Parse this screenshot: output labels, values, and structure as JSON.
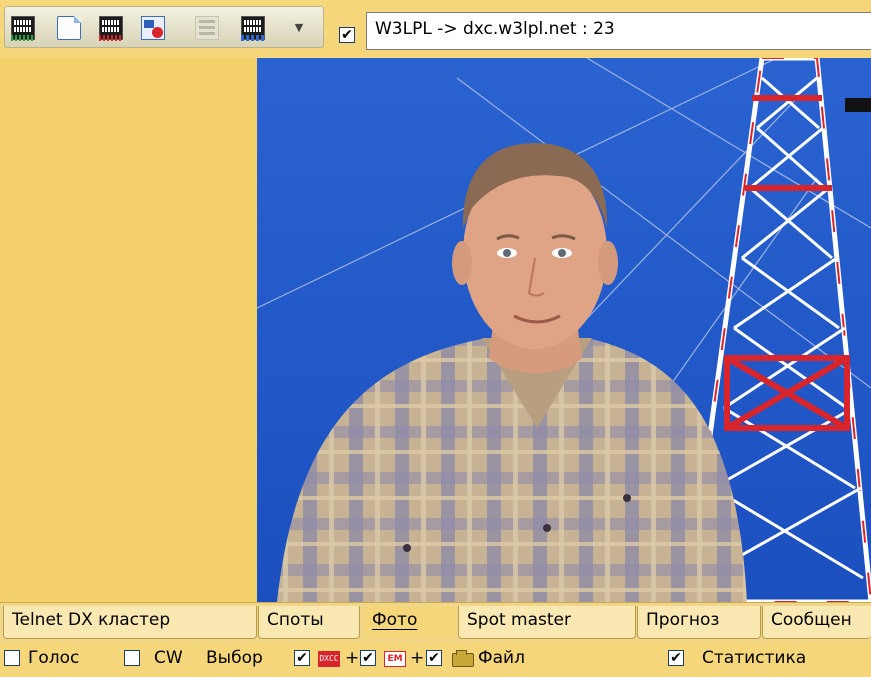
{
  "toolbar": {
    "buttons": [
      {
        "icon": "telnet-connect-icon"
      },
      {
        "icon": "new-document-icon"
      },
      {
        "icon": "telnet-disconnect-icon"
      },
      {
        "icon": "users-icon"
      },
      {
        "icon": "tree-icon"
      },
      {
        "icon": "telnet-settings-icon"
      },
      {
        "icon": "chevron-down-icon"
      }
    ],
    "connect_checked": true,
    "connection_text": "W3LPL -> dxc.w3lpl.net : 23"
  },
  "tabs": [
    {
      "label": "Telnet DX кластер",
      "active": false
    },
    {
      "label": "Споты",
      "active": false
    },
    {
      "label": "Фото",
      "active": true
    },
    {
      "label": "Spot master",
      "active": false
    },
    {
      "label": "Прогноз",
      "active": false
    },
    {
      "label": "Сообщен",
      "active": false
    }
  ],
  "statusbar": {
    "voice_label": "Голос",
    "voice_checked": false,
    "cw_label": "CW",
    "cw_checked": false,
    "select_label": "Выбор",
    "select_checked": true,
    "dxcc_icon_text": "DXCC",
    "plus1": "+",
    "em_checked": true,
    "em_icon_text": "EM",
    "plus2": "+",
    "file_checked": true,
    "file_label": "Файл",
    "stats_checked": true,
    "stats_label": "Статистика"
  },
  "colors": {
    "toolbar_bg": "#f5d67a",
    "left_pane": "#f3d06a",
    "sky": "#1f57c4",
    "tower_red": "#d8242b",
    "tower_white": "#ffffff"
  }
}
